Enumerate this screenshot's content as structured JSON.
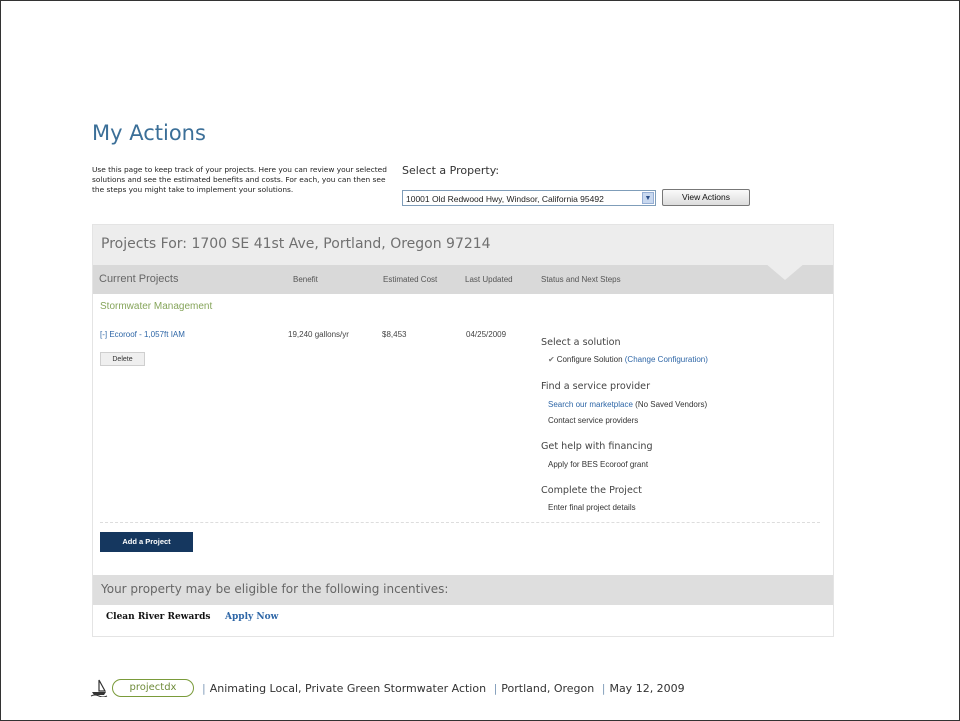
{
  "page": {
    "title": "My Actions",
    "intro": "Use this page to keep track of your projects. Here you can review your selected solutions and see the estimated benefits and costs. For each, you can then see the steps you might take to implement your solutions."
  },
  "property_selector": {
    "label": "Select a Property:",
    "selected_value": "10001 Old Redwood Hwy, Windsor, California 95492",
    "button_label": "View Actions"
  },
  "projects": {
    "header": "Projects For: 1700 SE 41st Ave, Portland, Oregon 97214",
    "columns": [
      "Current Projects",
      "Benefit",
      "Estimated Cost",
      "Last Updated",
      "Status and Next Steps"
    ],
    "section": "Stormwater Management",
    "row": {
      "name": "[-] Ecoroof - 1,057ft IAM",
      "benefit": "19,240 gallons/yr",
      "cost": "$8,453",
      "updated": "04/25/2009",
      "delete_label": "Delete"
    },
    "steps": [
      {
        "heading": "Select a solution",
        "items": [
          {
            "pre": "Configure Solution ",
            "link": "(Change Configuration)"
          }
        ]
      },
      {
        "heading": "Find a service provider",
        "items": [
          {
            "link": "Search our marketplace",
            "post": " (No Saved Vendors)"
          },
          {
            "pre": "Contact service providers"
          }
        ]
      },
      {
        "heading": "Get help with financing",
        "items": [
          {
            "link": "Apply for BES Ecoroof grant"
          }
        ]
      },
      {
        "heading": "Complete the Project",
        "items": [
          {
            "link": "Enter final project details"
          }
        ]
      }
    ],
    "add_label": "Add a Project"
  },
  "incentives": {
    "title": "Your property may be eligible for the following incentives:",
    "program": "Clean River Rewards",
    "apply_label": "Apply Now"
  },
  "footer": {
    "logo_text": "projectdx",
    "caption": "Animating Local, Private Green Stormwater Action",
    "location": "Portland, Oregon",
    "date": "May 12, 2009",
    "separator": "|"
  },
  "colors": {
    "title": "#3b6f98",
    "link": "#2f67a7",
    "add_button": "#15375f",
    "section": "#86a55b"
  }
}
